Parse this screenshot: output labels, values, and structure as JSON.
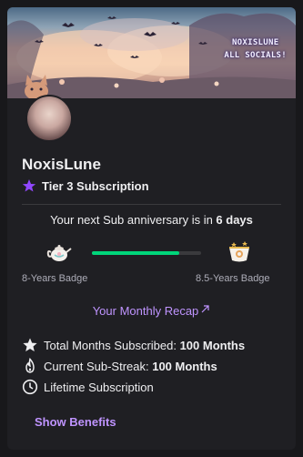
{
  "banner": {
    "line1": "NOXISLUNE",
    "line2": "ALL SOCIALS!"
  },
  "profile": {
    "username": "NoxisLune",
    "tier_label": "Tier 3 Subscription"
  },
  "anniversary": {
    "prefix": "Your next Sub anniversary is in ",
    "days": "6 days",
    "progress_fraction": 0.8,
    "current_badge_label": "8-Years Badge",
    "next_badge_label": "8.5-Years Badge"
  },
  "recap": {
    "label": "Your Monthly Recap"
  },
  "stats": {
    "total_label": "Total Months Subscribed: ",
    "total_value": "100 Months",
    "streak_label": "Current Sub-Streak: ",
    "streak_value": "100 Months",
    "lifetime_label": "Lifetime Subscription"
  },
  "benefits": {
    "label": "Show Benefits"
  },
  "colors": {
    "accent": "#bf94ff",
    "progress": "#00d67a",
    "tier_star": "#9147ff"
  }
}
